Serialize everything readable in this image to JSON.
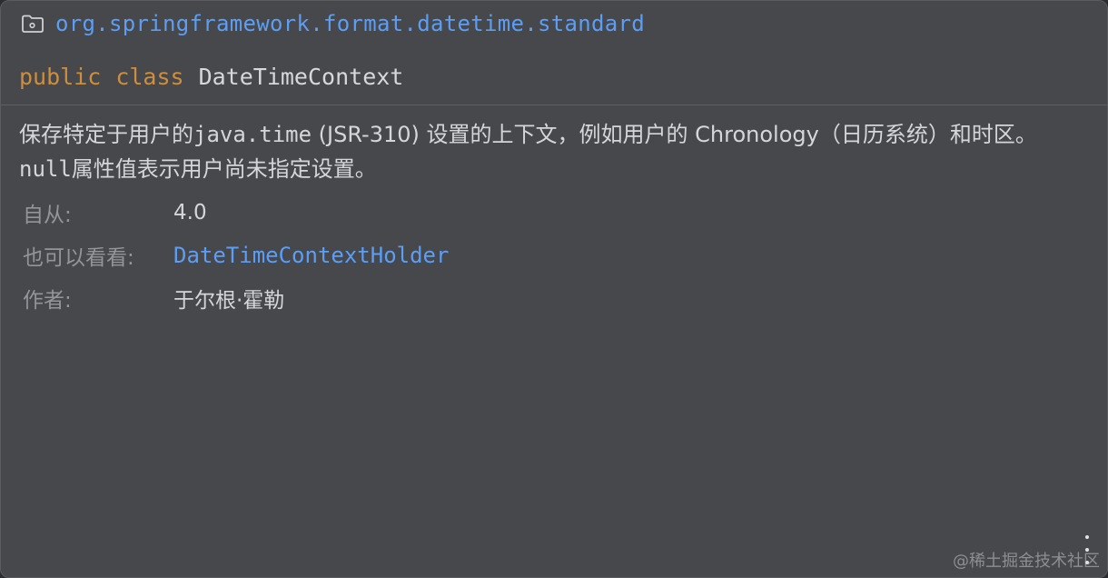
{
  "doc": {
    "package_icon": "package-folder-icon",
    "package_name": "org.springframework.format.datetime.standard",
    "declaration": {
      "modifier": "public",
      "keyword": "class",
      "class_name": "DateTimeContext"
    },
    "description": {
      "part1": "保存特定于用户的",
      "code1": "java.time",
      "part2": " (JSR-310) 设置的上下文，例如用户的 Chronology（日历系统）和时区。",
      "code2": "null",
      "part3": "属性值表示用户尚未指定设置。"
    },
    "meta": [
      {
        "key": "自从:",
        "value": "4.0"
      },
      {
        "key": "也可以看看:",
        "value": "DateTimeContextHolder"
      },
      {
        "key": "作者:",
        "value": "于尔根·霍勒"
      }
    ],
    "more_icon": "more-vertical-icon"
  },
  "watermark": "@稀土掘金技术社区",
  "colors": {
    "background": "#46484b",
    "link": "#5c9ef5",
    "keyword": "#cf8e3d",
    "text": "#d4d6da",
    "label": "#93959a"
  }
}
